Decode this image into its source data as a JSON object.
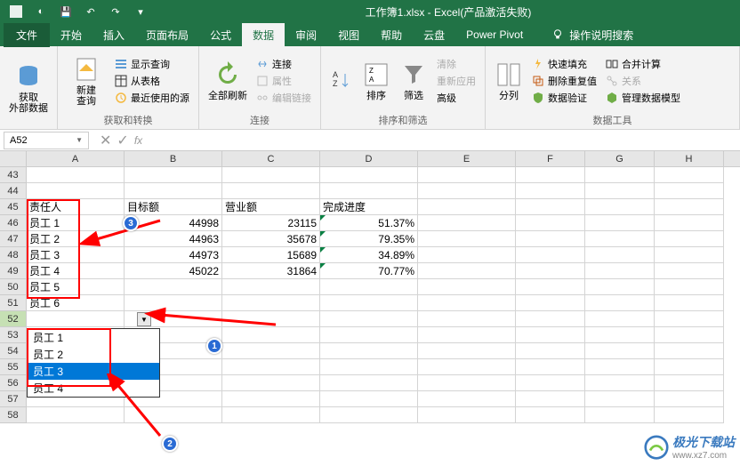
{
  "title": "工作簿1.xlsx - Excel(产品激活失败)",
  "menu": {
    "file": "文件",
    "tabs": [
      "开始",
      "插入",
      "页面布局",
      "公式",
      "数据",
      "审阅",
      "视图",
      "帮助",
      "云盘",
      "Power Pivot"
    ],
    "active": 4,
    "tell_me": "操作说明搜索"
  },
  "ribbon": {
    "g1": {
      "big": "获取\n外部数据",
      "label": ""
    },
    "g2": {
      "big": "新建\n查询",
      "s1": "显示查询",
      "s2": "从表格",
      "s3": "最近使用的源",
      "label": "获取和转换"
    },
    "g3": {
      "big": "全部刷新",
      "s1": "连接",
      "s2": "属性",
      "s3": "编辑链接",
      "label": "连接"
    },
    "g4": {
      "b1": "排序",
      "b2": "筛选",
      "s1": "清除",
      "s2": "重新应用",
      "s3": "高级",
      "label": "排序和筛选"
    },
    "g5": {
      "big": "分列",
      "s1": "快速填充",
      "s2": "删除重复值",
      "s3": "数据验证",
      "s4": "合并计算",
      "s5": "关系",
      "s6": "管理数据模型",
      "label": "数据工具"
    }
  },
  "namebox": "A52",
  "sheet": {
    "cols": [
      "A",
      "B",
      "C",
      "D",
      "E",
      "F",
      "G",
      "H"
    ],
    "rows_start": 43,
    "rows_end": 58,
    "headers": {
      "A": "责任人",
      "B": "目标额",
      "C": "营业额",
      "D": "完成进度"
    },
    "data": [
      {
        "a": "员工 1",
        "b": "44998",
        "c": "23115",
        "d": "51.37%"
      },
      {
        "a": "员工 2",
        "b": "44963",
        "c": "35678",
        "d": "79.35%"
      },
      {
        "a": "员工 3",
        "b": "44973",
        "c": "15689",
        "d": "34.89%"
      },
      {
        "a": "员工 4",
        "b": "45022",
        "c": "31864",
        "d": "70.77%"
      },
      {
        "a": "员工 5",
        "b": "",
        "c": "",
        "d": ""
      },
      {
        "a": "员工 6",
        "b": "",
        "c": "",
        "d": ""
      }
    ],
    "dropdown": {
      "items": [
        "员工 1",
        "员工 2",
        "员工 3",
        "员工 4"
      ],
      "selected": 2
    }
  },
  "watermark": {
    "name": "极光下载站",
    "url": "www.xz7.com"
  }
}
